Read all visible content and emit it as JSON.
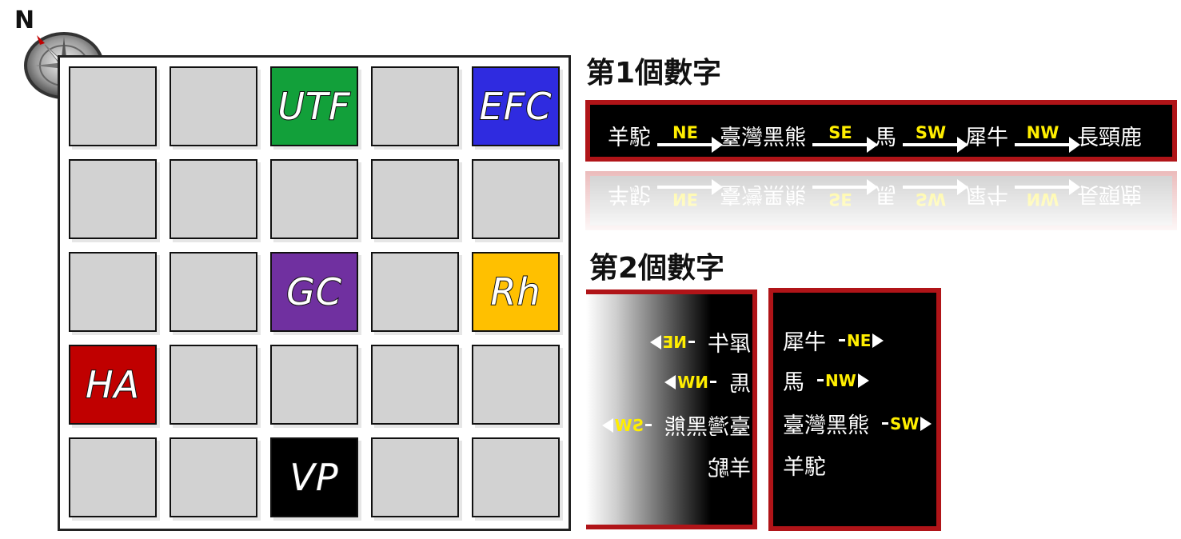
{
  "compass": {
    "north_label": "N",
    "icon": "compass-icon"
  },
  "grid": {
    "rows": 5,
    "cols": 5,
    "colors": {
      "tile": "#d2d2d2",
      "green": "#12a03a",
      "blue": "#2f2be0",
      "purple": "#7030a0",
      "orange": "#ffc000",
      "red": "#c00000",
      "black": "#000000"
    },
    "tiles": [
      {
        "row": 0,
        "col": 2,
        "label": "UTF",
        "color": "green"
      },
      {
        "row": 0,
        "col": 4,
        "label": "EFC",
        "color": "blue"
      },
      {
        "row": 2,
        "col": 2,
        "label": "GC",
        "color": "purple"
      },
      {
        "row": 2,
        "col": 4,
        "label": "Rh",
        "color": "orange"
      },
      {
        "row": 3,
        "col": 0,
        "label": "HA",
        "color": "red"
      },
      {
        "row": 4,
        "col": 2,
        "label": "VP",
        "color": "black"
      }
    ]
  },
  "clue1": {
    "title": "第1個數字",
    "chain": [
      {
        "animal": "羊駝"
      },
      {
        "direction": "NE",
        "animal": "臺灣黑熊"
      },
      {
        "direction": "SE",
        "animal": "馬"
      },
      {
        "direction": "SW",
        "animal": "犀牛"
      },
      {
        "direction": "NW",
        "animal": "長頸鹿"
      }
    ]
  },
  "clue2": {
    "title": "第2個數字",
    "items": [
      {
        "animal": "犀牛",
        "direction": "NE"
      },
      {
        "animal": "馬",
        "direction": "NW"
      },
      {
        "animal": "臺灣黑熊",
        "direction": "SW"
      },
      {
        "animal": "羊駝",
        "direction": ""
      }
    ]
  },
  "accent_color": "#b01418",
  "direction_color": "#ffee00"
}
